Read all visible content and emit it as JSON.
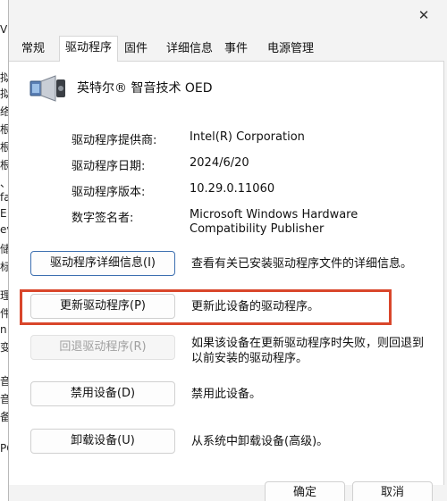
{
  "background_window": {
    "chars": [
      "V",
      "拟",
      "络",
      "根",
      "根",
      "根",
      "、",
      "fa",
      "E",
      "ev",
      "储",
      "标",
      "理",
      "件",
      "n",
      "变",
      "音",
      "音",
      "备",
      "PC"
    ]
  },
  "dialog": {
    "close_label": "✕",
    "tabs": [
      {
        "label": "常规"
      },
      {
        "label": "驱动程序"
      },
      {
        "label": "固件"
      },
      {
        "label": "详细信息"
      },
      {
        "label": "事件"
      },
      {
        "label": "电源管理"
      }
    ],
    "device_name": "英特尔® 智音技术 OED",
    "properties": [
      {
        "label": "驱动程序提供商:",
        "value": "Intel(R) Corporation"
      },
      {
        "label": "驱动程序日期:",
        "value": "2024/6/20"
      },
      {
        "label": "驱动程序版本:",
        "value": "10.29.0.11060"
      },
      {
        "label": "数字签名者:",
        "value": "Microsoft Windows Hardware Compatibility Publisher"
      }
    ],
    "actions": [
      {
        "button": "驱动程序详细信息(I)",
        "description": "查看有关已安装驱动程序文件的详细信息。"
      },
      {
        "button": "更新驱动程序(P)",
        "description": "更新此设备的驱动程序。"
      },
      {
        "button": "回退驱动程序(R)",
        "description": "如果该设备在更新驱动程序时失败，则回退到以前安装的驱动程序。"
      },
      {
        "button": "禁用设备(D)",
        "description": "禁用此设备。"
      },
      {
        "button": "卸载设备(U)",
        "description": "从系统中卸载设备(高级)。"
      }
    ],
    "footer": {
      "ok_label": "确定",
      "cancel_label": "取消"
    },
    "colors": {
      "highlight": "#d9462b",
      "focus_border": "#3d6fb0"
    }
  }
}
